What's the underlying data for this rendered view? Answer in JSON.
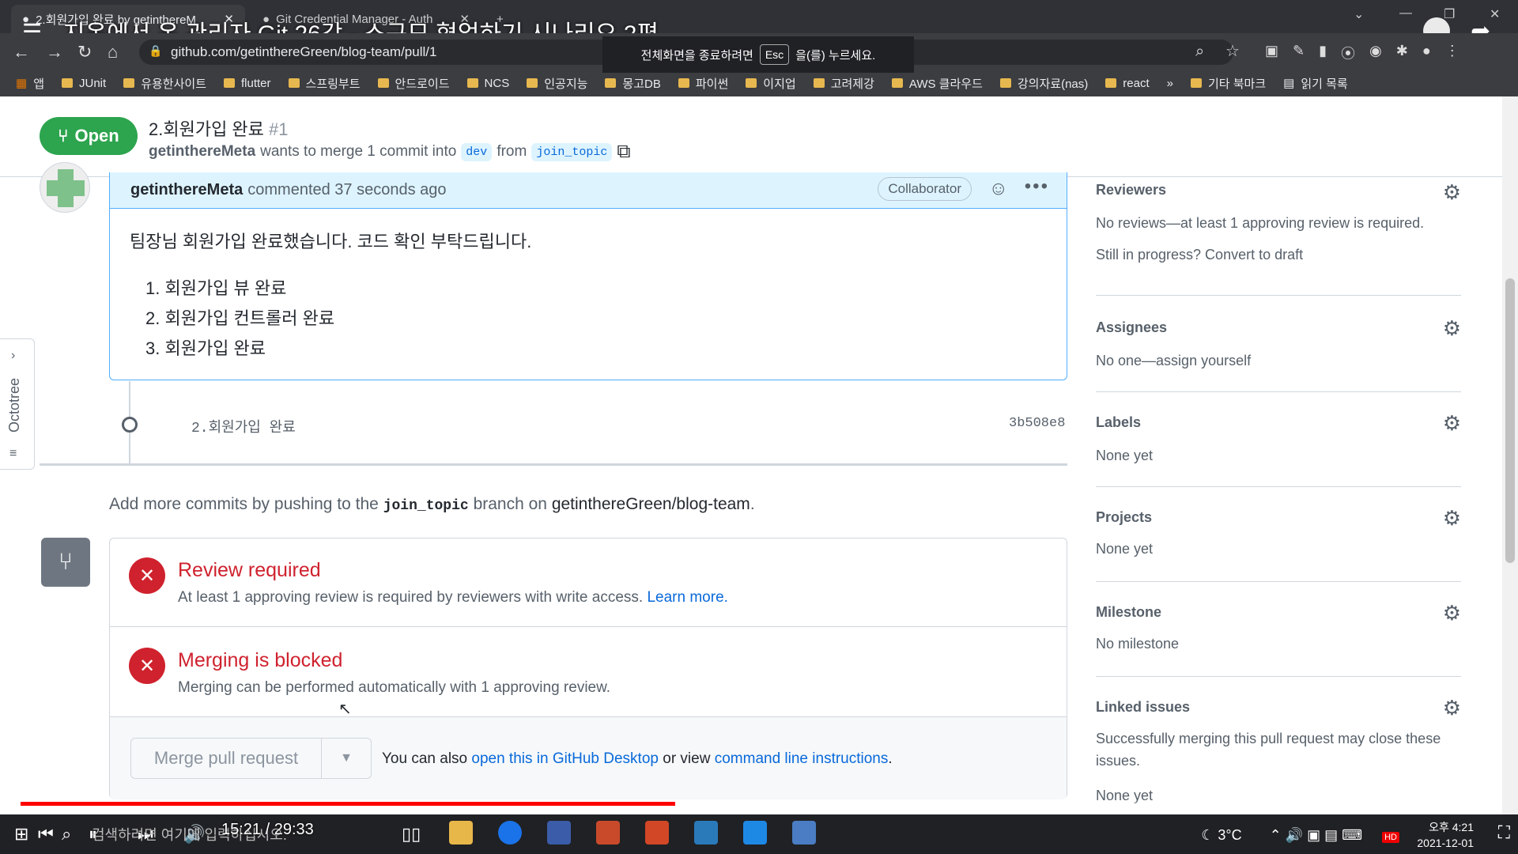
{
  "browser": {
    "tabs": [
      {
        "title": "2.회원가입 완료 by getinthereM"
      },
      {
        "title": "Git Credential Manager - Auth"
      }
    ],
    "url": "github.com/getinthereGreen/blog-team/pull/1",
    "bookmarks": [
      "앱",
      "JUnit",
      "유용한사이트",
      "flutter",
      "스프링부트",
      "안드로이드",
      "NCS",
      "인공지능",
      "몽고DB",
      "파이썬",
      "이지업",
      "고려제강",
      "AWS 클라우드",
      "강의자료(nas)",
      "react",
      "»",
      "기타 북마크",
      "읽기 목록"
    ],
    "fullscreen_toast": {
      "before": "전체화면을 종료하려면",
      "key": "Esc",
      "after": "을(를) 누르세요."
    }
  },
  "video": {
    "title": "지옥에서 온 관리자 Git 26강 - 소규모 협업하기 시나리오 2편",
    "time": "15:21 / 29:33",
    "progress": 0.443,
    "buffered": 0.44,
    "quality": "HD"
  },
  "pr": {
    "state": "Open",
    "title": "2.회원가입 완료",
    "number": "#1",
    "author": "getinthereMeta",
    "action": "wants to merge 1 commit into",
    "base": "dev",
    "from": "from",
    "head": "join_topic"
  },
  "comment": {
    "author": "getinthereMeta",
    "meta": "commented 37 seconds ago",
    "role": "Collaborator",
    "body": "팀장님 회원가입 완료했습니다. 코드 확인 부탁드립니다.",
    "items": [
      "1. 회원가입 뷰 완료",
      "2. 회원가입 컨트롤러 완료",
      "3. 회원가입 완료"
    ]
  },
  "commit": {
    "message": "2.회원가입 완료",
    "sha": "3b508e8"
  },
  "push_hint": {
    "pre": "Add more commits by pushing to the",
    "branch": "join_topic",
    "mid": "branch on",
    "repo": "getinthereGreen/blog-team",
    "end": "."
  },
  "checks": [
    {
      "title": "Review required",
      "desc": "At least 1 approving review is required by reviewers with write access.",
      "link": "Learn more."
    },
    {
      "title": "Merging is blocked",
      "desc": "Merging can be performed automatically with 1 approving review."
    }
  ],
  "merge": {
    "button": "Merge pull request",
    "alt_pre": "You can also",
    "alt_link1": "open this in GitHub Desktop",
    "alt_mid": "or view",
    "alt_link2": "command line instructions",
    "alt_end": "."
  },
  "sidebar": {
    "reviewers": {
      "title": "Reviewers",
      "line1": "No reviews—at least 1 approving review is required.",
      "line2": "Still in progress? Convert to draft"
    },
    "assignees": {
      "title": "Assignees",
      "text": "No one—assign yourself"
    },
    "labels": {
      "title": "Labels",
      "text": "None yet"
    },
    "projects": {
      "title": "Projects",
      "text": "None yet"
    },
    "milestone": {
      "title": "Milestone",
      "text": "No milestone"
    },
    "linked": {
      "title": "Linked issues",
      "text": "Successfully merging this pull request may close these issues.",
      "text2": "None yet"
    }
  },
  "octotree": "Octotree",
  "taskbar": {
    "search_placeholder": "검색하려면 여기에 입력하십시오.",
    "temperature": "3°C",
    "date": "2021-12-01",
    "time": "오후 4:21"
  }
}
